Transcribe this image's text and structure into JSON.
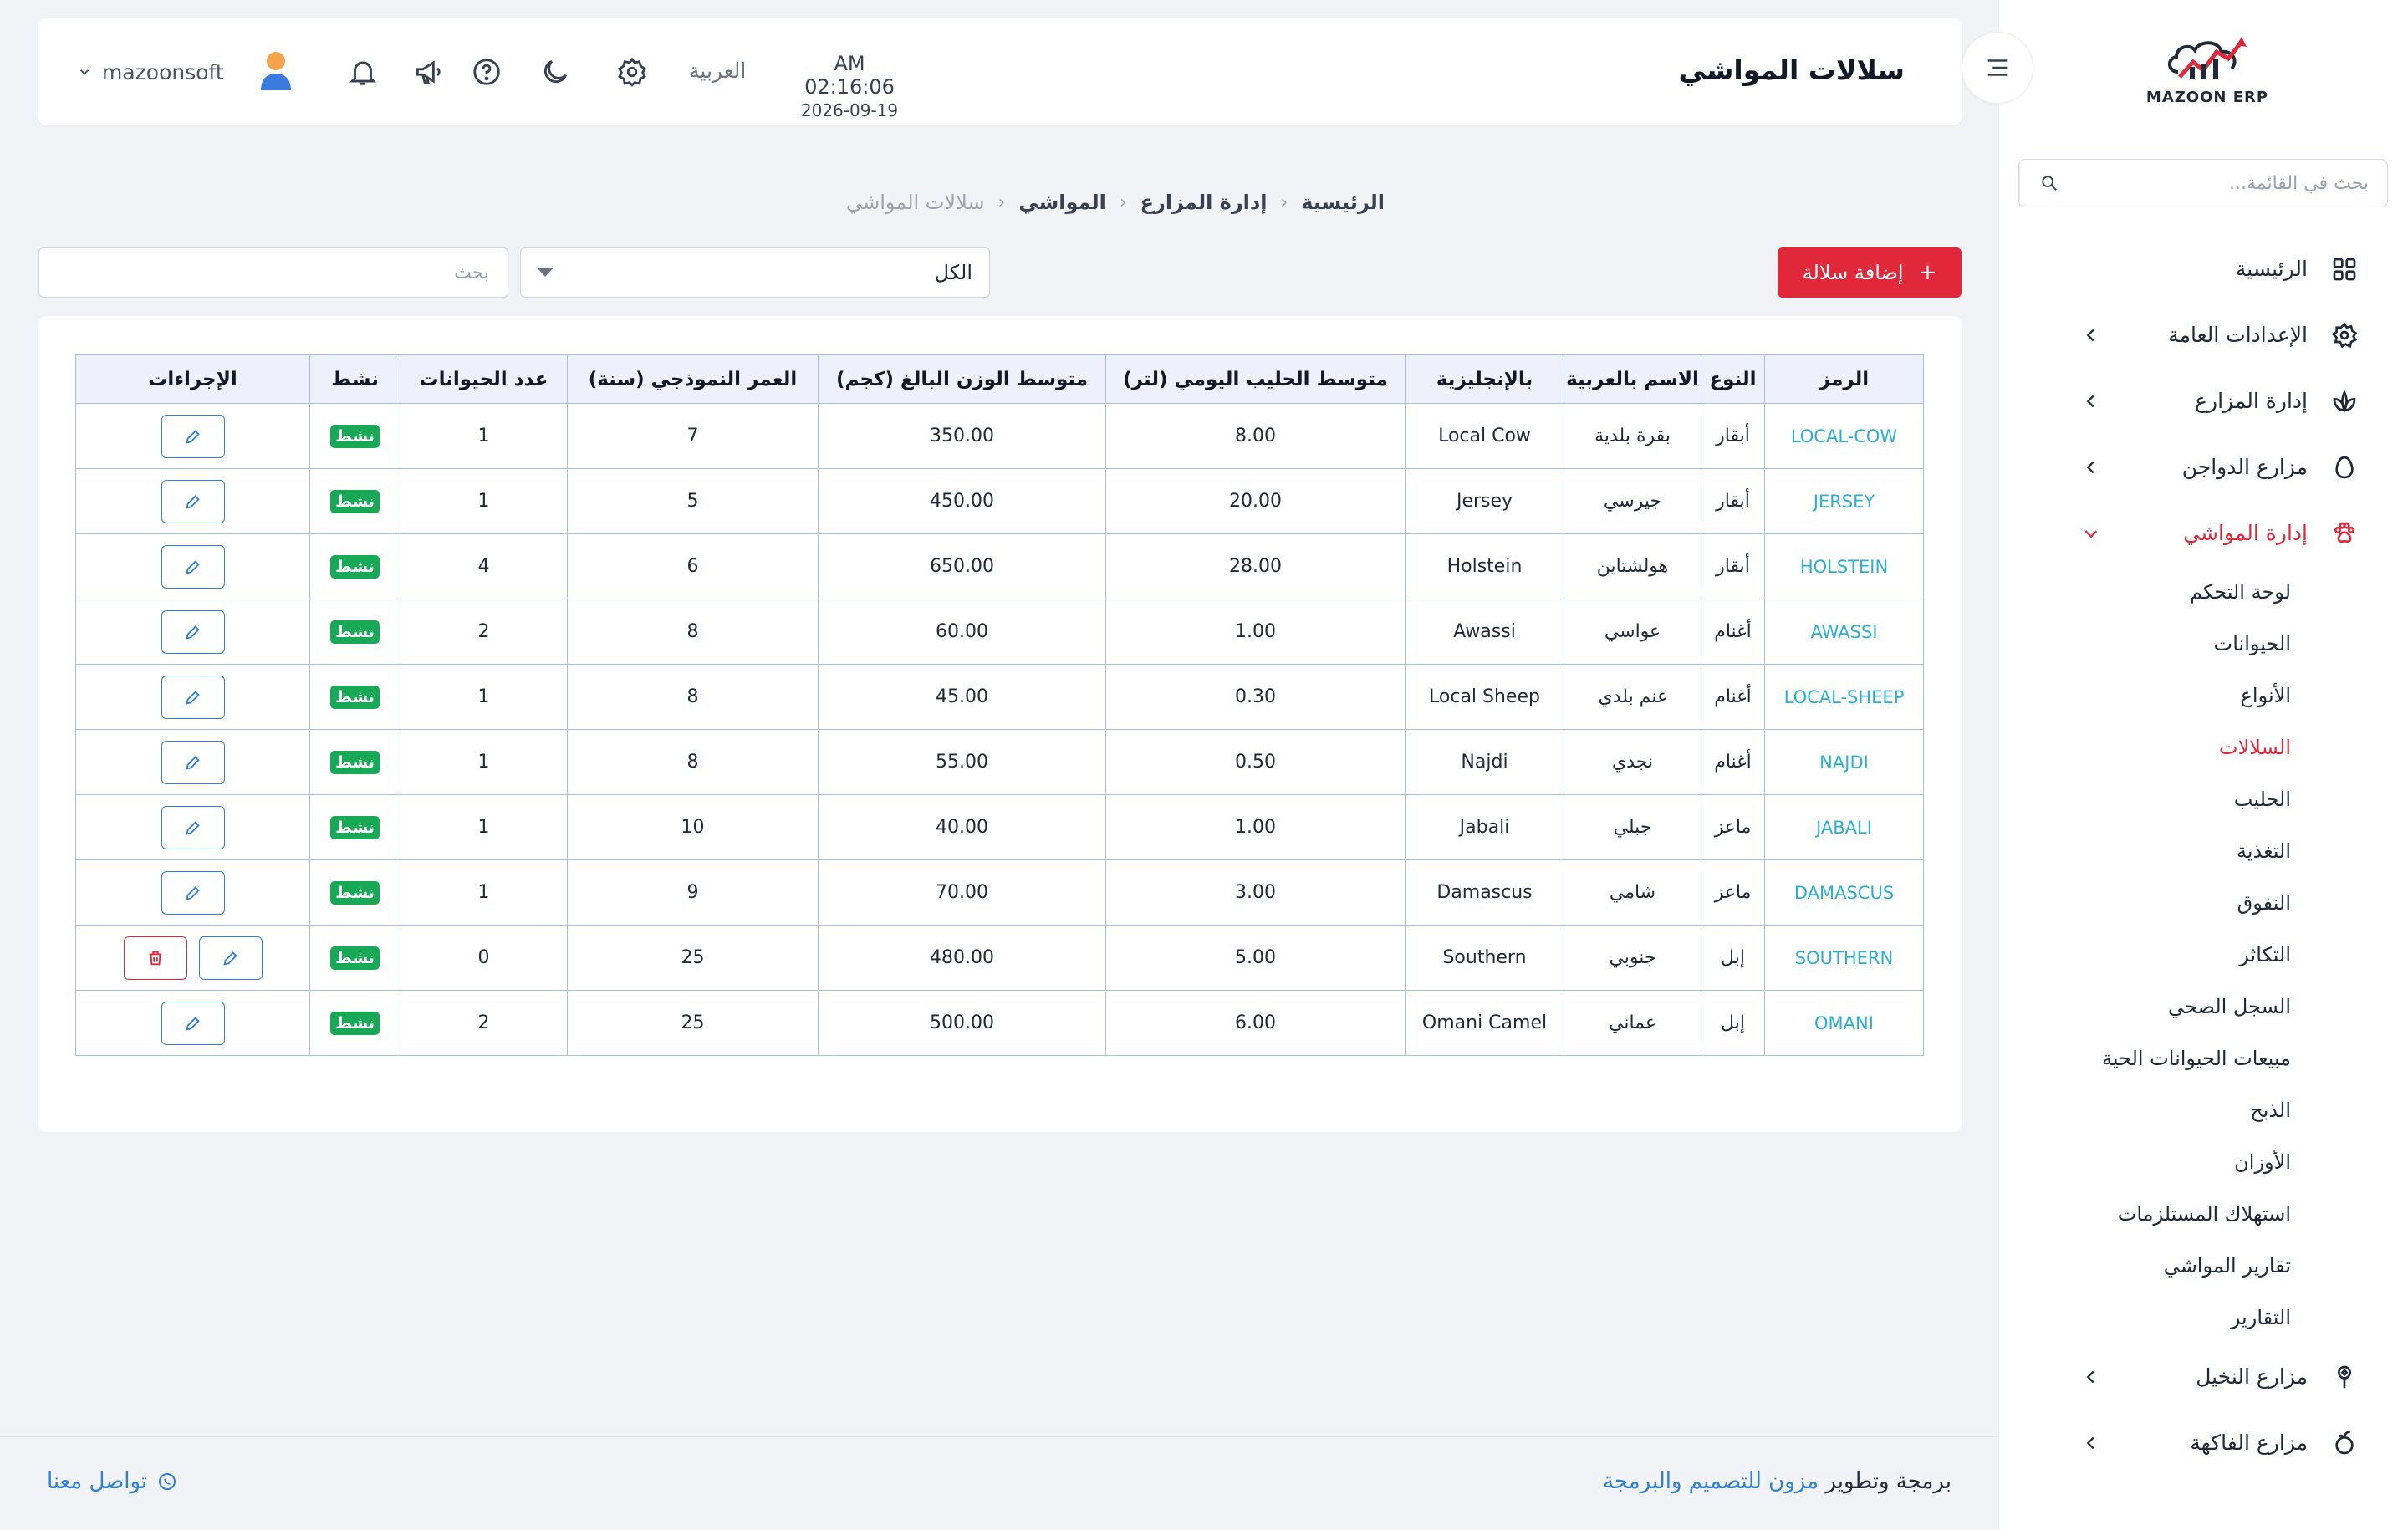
{
  "sidebar": {
    "logo_text": "MAZOON ERP",
    "search_placeholder": "بحث في القائمة...",
    "menu_top": [
      {
        "label": "الرئيسية",
        "icon": "grid-icon",
        "has_children": false
      },
      {
        "label": "الإعدادات العامة",
        "icon": "gear-icon",
        "has_children": true
      },
      {
        "label": "إدارة المزارع",
        "icon": "leaf-icon",
        "has_children": true
      },
      {
        "label": "مزارع الدواجن",
        "icon": "egg-icon",
        "has_children": true
      },
      {
        "label": "إدارة المواشي",
        "icon": "paw-icon",
        "has_children": true,
        "active": true
      }
    ],
    "submenu": [
      {
        "label": "لوحة التحكم"
      },
      {
        "label": "الحيوانات"
      },
      {
        "label": "الأنواع"
      },
      {
        "label": "السلالات",
        "active": true
      },
      {
        "label": "الحليب"
      },
      {
        "label": "التغذية"
      },
      {
        "label": "النفوق"
      },
      {
        "label": "التكاثر"
      },
      {
        "label": "السجل الصحي"
      },
      {
        "label": "مبيعات الحيوانات الحية"
      },
      {
        "label": "الذبح"
      },
      {
        "label": "الأوزان"
      },
      {
        "label": "استهلاك المستلزمات"
      },
      {
        "label": "تقارير المواشي"
      },
      {
        "label": "التقارير"
      }
    ],
    "menu_bottom": [
      {
        "label": "مزارع النخيل",
        "icon": "palm-icon",
        "has_children": true
      },
      {
        "label": "مزارع الفاكهة",
        "icon": "fruit-icon",
        "has_children": true
      }
    ]
  },
  "header": {
    "title": "سلالات المواشي",
    "time": "AM 02:16:06",
    "date": "2026-09-19",
    "language": "العربية",
    "username": "mazoonsoft"
  },
  "breadcrumb": [
    "الرئيسية",
    "إدارة المزارع",
    "المواشي",
    "سلالات المواشي"
  ],
  "toolbar": {
    "add_label": "إضافة سلالة",
    "filter_value": "الكل",
    "search_placeholder": "بحث"
  },
  "table": {
    "headers": [
      "الرمز",
      "النوع",
      "الاسم بالعربية",
      "بالإنجليزية",
      "متوسط الحليب اليومي (لتر)",
      "متوسط الوزن البالغ (كجم)",
      "العمر النموذجي (سنة)",
      "عدد الحيوانات",
      "نشط",
      "الإجراءات"
    ],
    "rows": [
      {
        "code": "LOCAL-COW",
        "type": "أبقار",
        "name_ar": "بقرة بلدية",
        "name_en": "Local Cow",
        "milk": "8.00",
        "weight": "350.00",
        "age": "7",
        "count": "1",
        "status": "نشط",
        "deletable": false
      },
      {
        "code": "JERSEY",
        "type": "أبقار",
        "name_ar": "جيرسي",
        "name_en": "Jersey",
        "milk": "20.00",
        "weight": "450.00",
        "age": "5",
        "count": "1",
        "status": "نشط",
        "deletable": false
      },
      {
        "code": "HOLSTEIN",
        "type": "أبقار",
        "name_ar": "هولشتاين",
        "name_en": "Holstein",
        "milk": "28.00",
        "weight": "650.00",
        "age": "6",
        "count": "4",
        "status": "نشط",
        "deletable": false
      },
      {
        "code": "AWASSI",
        "type": "أغنام",
        "name_ar": "عواسي",
        "name_en": "Awassi",
        "milk": "1.00",
        "weight": "60.00",
        "age": "8",
        "count": "2",
        "status": "نشط",
        "deletable": false
      },
      {
        "code": "LOCAL-SHEEP",
        "type": "أغنام",
        "name_ar": "غنم بلدي",
        "name_en": "Local Sheep",
        "milk": "0.30",
        "weight": "45.00",
        "age": "8",
        "count": "1",
        "status": "نشط",
        "deletable": false
      },
      {
        "code": "NAJDI",
        "type": "أغنام",
        "name_ar": "نجدي",
        "name_en": "Najdi",
        "milk": "0.50",
        "weight": "55.00",
        "age": "8",
        "count": "1",
        "status": "نشط",
        "deletable": false
      },
      {
        "code": "JABALI",
        "type": "ماعز",
        "name_ar": "جبلي",
        "name_en": "Jabali",
        "milk": "1.00",
        "weight": "40.00",
        "age": "10",
        "count": "1",
        "status": "نشط",
        "deletable": false
      },
      {
        "code": "DAMASCUS",
        "type": "ماعز",
        "name_ar": "شامي",
        "name_en": "Damascus",
        "milk": "3.00",
        "weight": "70.00",
        "age": "9",
        "count": "1",
        "status": "نشط",
        "deletable": false
      },
      {
        "code": "SOUTHERN",
        "type": "إبل",
        "name_ar": "جنوبي",
        "name_en": "Southern",
        "milk": "5.00",
        "weight": "480.00",
        "age": "25",
        "count": "0",
        "status": "نشط",
        "deletable": true
      },
      {
        "code": "OMANI",
        "type": "إبل",
        "name_ar": "عماني",
        "name_en": "Omani Camel",
        "milk": "6.00",
        "weight": "500.00",
        "age": "25",
        "count": "2",
        "status": "نشط",
        "deletable": false
      }
    ]
  },
  "footer": {
    "credit_prefix": "برمجة وتطوير",
    "credit_link": "مزون للتصميم والبرمجة",
    "contact": "تواصل معنا"
  },
  "colors": {
    "accent": "#e0283a",
    "link": "#2f80d6",
    "code_text": "#2bb0d3",
    "badge": "#18a957"
  }
}
